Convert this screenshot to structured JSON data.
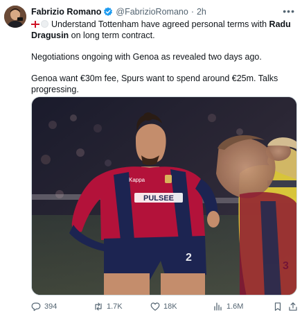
{
  "author": {
    "name": "Fabrizio Romano",
    "handle": "@FabrizioRomano",
    "separator": "·",
    "time": "2h",
    "verified": true,
    "verified_color": "#1d9bf0"
  },
  "more_icon": "more-icon",
  "tweet": {
    "line1_flags": [
      "england-flag",
      "white-circle"
    ],
    "line1_text": "Understand Tottenham have agreed personal terms with ",
    "line1_bold": "Radu Dragusin",
    "line1_tail": " on long term contract.",
    "line2": "Negotiations ongoing with Genoa as revealed two days ago.",
    "line3": "Genoa want €30m fee, Spurs want to spend around €25m. Talks progressing."
  },
  "media": {
    "description_icon": "football-player-photo",
    "shirt_sponsor": "PULSEE",
    "shirt_brand": "Kappa",
    "player_number": "3"
  },
  "actions": {
    "replies": "394",
    "reposts": "1.7K",
    "likes": "18K",
    "views": "1.6M"
  },
  "colors": {
    "text": "#0f1419",
    "muted": "#536471",
    "genoa_red": "#b3123a",
    "genoa_navy": "#1c2451"
  }
}
